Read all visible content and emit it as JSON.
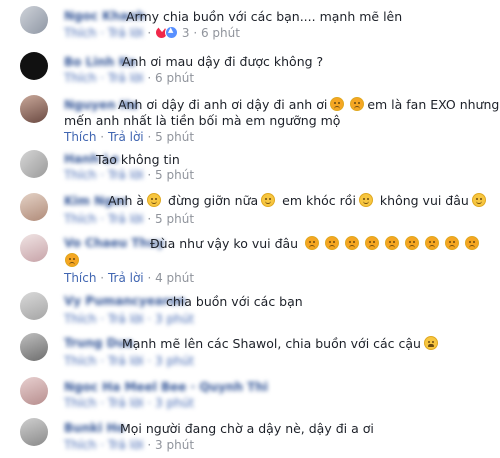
{
  "labels": {
    "like": "Thích",
    "reply": "Trả lời",
    "dot": "·"
  },
  "comments": [
    {
      "text": "Army chia buồn với các bạn.... mạnh mẽ lên",
      "reactions": "3",
      "time": "6 phút"
    },
    {
      "text": "Anh ơi mau dậy đi được không ?",
      "time": "6 phút"
    },
    {
      "line1": "Anh ơi dậy đi anh ơi dậy đi anh ơi",
      "line1b": "em là fan EXO nhưng em",
      "line2": "mến anh nhất là tiền bối mà em ngưỡng mộ",
      "time": "5 phút"
    },
    {
      "text": "Tao không tin",
      "time": "5 phút"
    },
    {
      "p1": "Anh à",
      "p2": "đừng giỡn nữa",
      "p3": "em khóc rồi",
      "p4": "không vui đâu",
      "time": "5 phút"
    },
    {
      "text": "Đùa như vậy ko vui đâu",
      "time": "4 phút"
    },
    {
      "text": "chia buồn với các bạn"
    },
    {
      "text": "Mạnh mẽ lên các Shawol, chia buồn với các cậu"
    },
    {
      "text": ""
    },
    {
      "text": "Mọi người đang chờ a dậy nè, dậy đi a ơi",
      "time": "3 phút"
    }
  ]
}
